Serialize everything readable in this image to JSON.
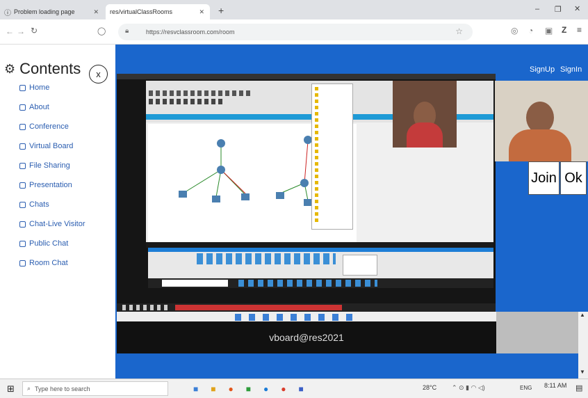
{
  "browser": {
    "tabs": [
      {
        "label": "Problem loading page"
      },
      {
        "label": "res/virtualClassRooms"
      }
    ],
    "url": "https://resvclassroom.com/room"
  },
  "sidebar": {
    "title": "Contents",
    "close_label": "x",
    "items": [
      {
        "label": "Home"
      },
      {
        "label": "About"
      },
      {
        "label": "Conference"
      },
      {
        "label": "Virtual Board"
      },
      {
        "label": "File Sharing"
      },
      {
        "label": "Presentation"
      },
      {
        "label": "Chats"
      },
      {
        "label": "Chat-Live Visitor"
      },
      {
        "label": "Public Chat"
      },
      {
        "label": "Room Chat"
      }
    ]
  },
  "header": {
    "signup": "SignUp",
    "signin": "SignIn"
  },
  "room": {
    "join_label": "Join",
    "ok_label": "Ok",
    "board_email": "vboard@res2021"
  },
  "taskbar": {
    "search_placeholder": "Type here to search",
    "temperature": "28°C",
    "language": "ENG",
    "time": "8:11 AM"
  }
}
